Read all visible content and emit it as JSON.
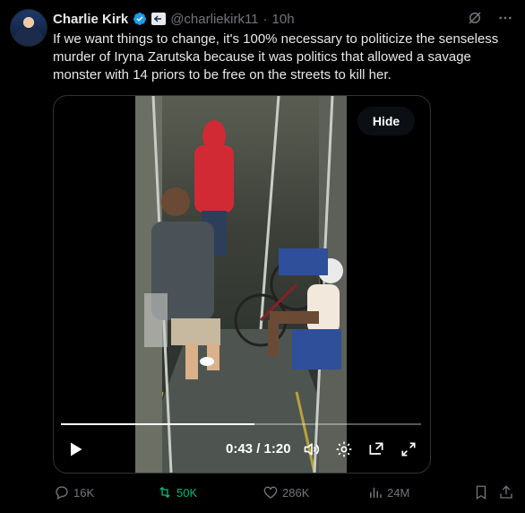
{
  "author": {
    "name": "Charlie Kirk",
    "handle": "@charliekirk11",
    "separator": "·",
    "time": "10h"
  },
  "tweet": {
    "text": "If we want things to change, it's 100% necessary to politicize the senseless murder of Iryna Zarutska because it was politics that allowed a savage monster with 14 priors to be free on the streets to kill her."
  },
  "media": {
    "hide_label": "Hide",
    "time_display": "0:43 / 1:20",
    "progress": 0.5375
  },
  "actions": {
    "replies": "16K",
    "reposts": "50K",
    "likes": "286K",
    "views": "24M"
  },
  "colors": {
    "background": "#000000",
    "text": "#e7e9ea",
    "muted": "#71767b",
    "verified": "#1d9bf0",
    "repost_active": "#00ba7c"
  },
  "icons": [
    "verified-badge-icon",
    "affiliate-icon",
    "grok-icon",
    "more-icon",
    "play-icon",
    "volume-icon",
    "settings-icon",
    "pip-icon",
    "fullscreen-icon",
    "reply-icon",
    "repost-icon",
    "like-icon",
    "views-icon",
    "bookmark-icon",
    "share-icon"
  ]
}
